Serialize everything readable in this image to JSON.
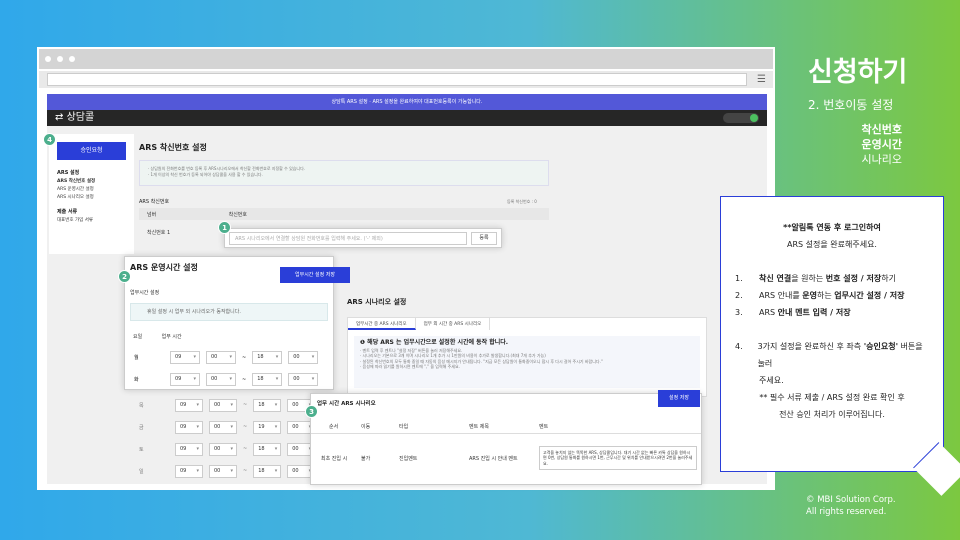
{
  "slide": {
    "title": "신청하기",
    "subtitle": "2. 번호이동 설정",
    "items": [
      "착신번호",
      "운영시간",
      "시나리오"
    ],
    "copyright": [
      "© MBI Solution Corp.",
      "All rights reserved."
    ]
  },
  "app": {
    "notice": "상담톡 ARS 설정 · ARS 설정을 완료하여야 대표번호등록이 가능합니다.",
    "brand": "상담콜"
  },
  "sidebar": {
    "approve_button": "승인요청",
    "badge": "4",
    "group1": "ARS 설정",
    "items": [
      "ARS 착신번호 설정",
      "ARS 운영시간 설정",
      "ARS 시나리오 설정"
    ],
    "group2": "제출 서류",
    "items2": [
      "대표번호 가입 서류"
    ]
  },
  "main": {
    "title": "ARS 착신번호 설정",
    "info": [
      "· 상담원의 전화번호를 번호 등록 후 ARS시나리오에서 착신할 전화번호로 지정할 수 있습니다.",
      "· 1개 이상의 착신 번호가 등록 되어야 상담콜을 사용 할 수 있습니다."
    ],
    "table_label": "ARS 착신번호",
    "table_count": "등록 착신번호 : 0",
    "col_no": "넘버",
    "col_number": "착신번호",
    "row_label": "착신번호 1"
  },
  "step1": {
    "badge": "1",
    "placeholder": "ARS 시나리오에서 연결할 상담원 전화번호를 입력해 주세요. ('-' 제외)",
    "register": "등록"
  },
  "step2": {
    "badge": "2",
    "title": "ARS 운영시간 설정",
    "save": "업무시간 설정 저장",
    "sub": "업무시간 설정",
    "notice": "휴일 설정 시 업무 외 시나리오가 동작합니다.",
    "col_day": "요일",
    "col_time": "업무 시간",
    "rows": [
      {
        "day": "월",
        "h1": "09",
        "m1": "00",
        "h2": "18",
        "m2": "00"
      },
      {
        "day": "화",
        "h1": "09",
        "m1": "00",
        "h2": "18",
        "m2": "00"
      }
    ],
    "dash": "~"
  },
  "grey_rows": [
    {
      "day": "목",
      "h1": "09",
      "m1": "00",
      "h2": "18",
      "m2": "00"
    },
    {
      "day": "금",
      "h1": "09",
      "m1": "00",
      "h2": "19",
      "m2": "00"
    },
    {
      "day": "토",
      "h1": "09",
      "m1": "00",
      "h2": "18",
      "m2": "00"
    },
    {
      "day": "일",
      "h1": "09",
      "m1": "00",
      "h2": "18",
      "m2": "00"
    }
  ],
  "ars": {
    "title": "ARS 시나리오 설정",
    "tab1": "업무시간 중 ARS 시나리오",
    "tab2": "업무 외 시간 중 ARS 시나리오",
    "note_title": "❶ 해당 ARS 는 업무시간으로 설정한 시간에 동작 합니다.",
    "notes": [
      "· 멘트 입력 후 멘트나 \"설정 저장\" 버튼을 눌러 저장해주세요.",
      "· 시나리오는 기본으로 3개 이며 시나리오 1개 추가 시 1만원의 비용이 추가로 발생합니다.(최대 7개 추가 가능)",
      "· 설정된 착신번호의 모두 통화 중일 때 자동의 음성 메시지가 안내됩니다. \"지금 모든 상담원이 통화중이오니 잠시 후 다시 걸어 주시기 바랍니다.\"",
      "· 음성에 따라 읽기를 원하시면 멘트에 \",\" 을 입력해 주세요."
    ]
  },
  "step3": {
    "badge": "3",
    "title": "업무 시간 ARS 시나리오",
    "save": "설정 저장",
    "cols": [
      "순서",
      "이동",
      "타입",
      "멘트 제목",
      "멘트"
    ],
    "row": {
      "order": "최초 진입 시",
      "move": "불가",
      "type": "진입멘트",
      "mtitle": "ARS 진입 시 안내 멘트",
      "ment": "고객을 놓치지 않는 똑똑한 ARS, 상담콜입니다. 대기 시간 없는 빠른 카톡 상담을 원하시면 0번, 상담원 통화를 원하시면 1번, 근무시간 및 위치를 안내받으시려면 2번을 눌러주세요."
    }
  },
  "memo": {
    "intro1": "**알림톡 연동 후 로그인하여",
    "intro2": "ARS 설정을 완료해주세요.",
    "items": [
      {
        "n": "1.",
        "pre": "",
        "bold1": "착신 연결",
        "mid": "을 원하는 ",
        "bold2": "번호 설정 / 저장",
        "post": "하기"
      },
      {
        "n": "2.",
        "pre": "ARS 안내를 ",
        "bold1": "운영",
        "mid": "하는 ",
        "bold2": "업무시간 설정 / 저장",
        "post": ""
      },
      {
        "n": "3.",
        "pre": "ARS ",
        "bold1": "안내 멘트 입력 / 저장",
        "mid": "",
        "bold2": "",
        "post": ""
      }
    ],
    "item4_n": "4.",
    "item4_a": "3가지 설정을 완료하신 후 좌측 ",
    "item4_b": "'승인요청'",
    "item4_c": " 버튼을 눌러",
    "item4_d": "주세요.",
    "foot1": "** 필수 서류 제출 / ARS 설정 완료 확인 후",
    "foot2": "전산 승인 처리가 이루어집니다."
  }
}
